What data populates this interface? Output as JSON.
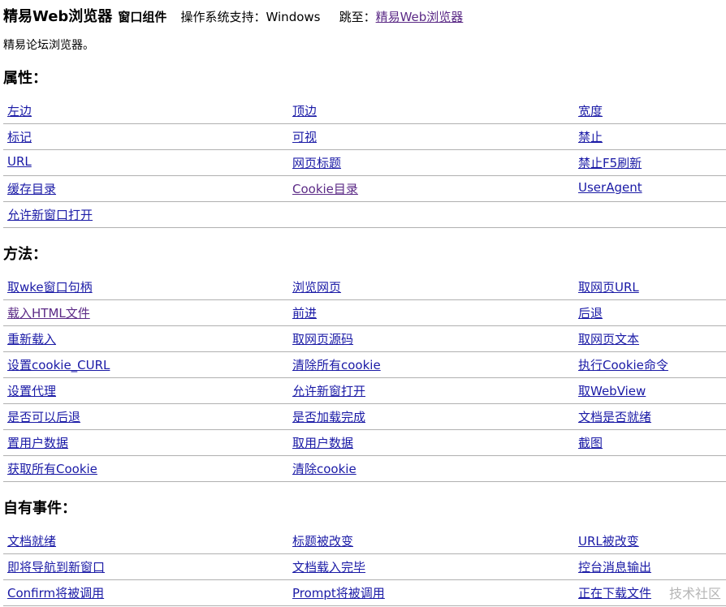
{
  "header": {
    "title": "精易Web浏览器",
    "subtitle": "窗口组件",
    "support": "操作系统支持：Windows",
    "jump_label": "跳至：",
    "jump_link": "精易Web浏览器"
  },
  "description": "精易论坛浏览器。",
  "sections": {
    "properties": {
      "title": "属性：",
      "rows": [
        [
          "左边",
          "顶边",
          "宽度"
        ],
        [
          "标记",
          "可视",
          "禁止"
        ],
        [
          "URL",
          "网页标题",
          "禁止F5刷新"
        ],
        [
          "缓存目录",
          "Cookie目录",
          "UserAgent"
        ],
        [
          "允许新窗口打开",
          "",
          ""
        ]
      ]
    },
    "methods": {
      "title": "方法：",
      "rows": [
        [
          "取wke窗口句柄",
          "浏览网页",
          "取网页URL"
        ],
        [
          "载入HTML文件",
          "前进",
          "后退"
        ],
        [
          "重新载入",
          "取网页源码",
          "取网页文本"
        ],
        [
          "设置cookie_CURL",
          "清除所有cookie",
          "执行Cookie命令"
        ],
        [
          "设置代理",
          "允许新窗打开",
          "取WebView"
        ],
        [
          "是否可以后退",
          "是否加载完成",
          "文档是否就绪"
        ],
        [
          "置用户数据",
          "取用户数据",
          "截图"
        ],
        [
          "获取所有Cookie",
          "清除cookie",
          ""
        ]
      ]
    },
    "events": {
      "title": "自有事件：",
      "rows": [
        [
          "文档就绪",
          "标题被改变",
          "URL被改变"
        ],
        [
          "即将导航到新窗口",
          "文档载入完毕",
          "控台消息输出"
        ],
        [
          "Confirm将被调用",
          "Prompt将被调用",
          "正在下载文件"
        ]
      ]
    }
  },
  "watermark": "技术社区"
}
